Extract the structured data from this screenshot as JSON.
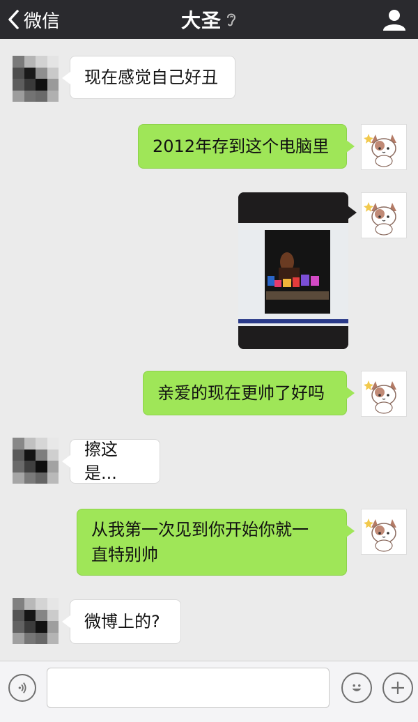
{
  "header": {
    "back_label": "微信",
    "title": "大圣",
    "bg_color": "#2a2a2e"
  },
  "messages": [
    {
      "side": "left",
      "type": "text",
      "text": "现在感觉自己好丑"
    },
    {
      "side": "right",
      "type": "text",
      "text": "2012年存到这个电脑里"
    },
    {
      "side": "right",
      "type": "image",
      "description": "photo"
    },
    {
      "side": "right",
      "type": "text",
      "text": "亲爱的现在更帅了好吗"
    },
    {
      "side": "left",
      "type": "text",
      "text": "擦这是..."
    },
    {
      "side": "right",
      "type": "text",
      "text": "从我第一次见到你开始你就一直特别帅",
      "lines": [
        "从我第一次见到你开始你就一",
        "直特别帅"
      ]
    },
    {
      "side": "left",
      "type": "text",
      "text": "微博上的?"
    }
  ],
  "input": {
    "value": "",
    "placeholder": ""
  },
  "colors": {
    "chat_bg": "#ebebeb",
    "right_bubble": "#9fe658",
    "left_bubble": "#ffffff"
  },
  "icons": [
    "back-chevron-icon",
    "ear-icon",
    "person-icon",
    "voice-icon",
    "emoji-icon",
    "plus-icon"
  ]
}
